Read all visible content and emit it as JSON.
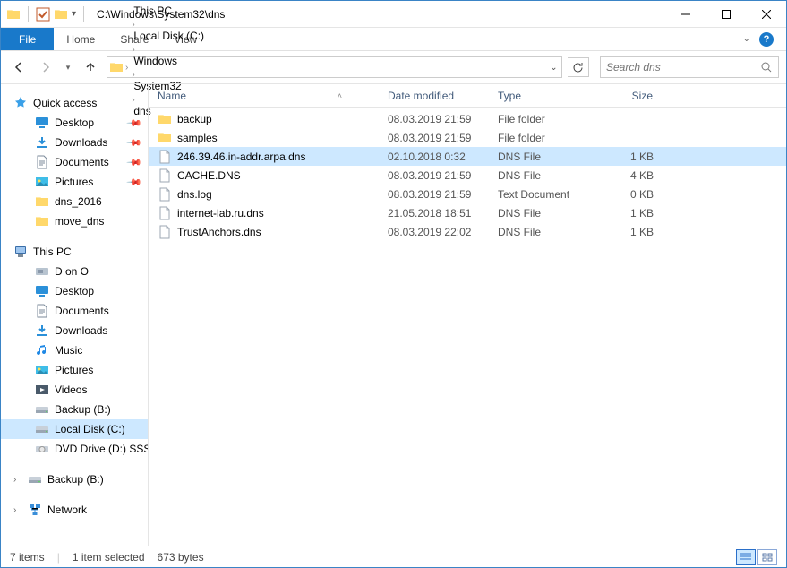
{
  "title": "C:\\Windows\\System32\\dns",
  "ribbon": {
    "file": "File",
    "home": "Home",
    "share": "Share",
    "view": "View"
  },
  "breadcrumbs": [
    "This PC",
    "Local Disk (C:)",
    "Windows",
    "System32",
    "dns"
  ],
  "search_placeholder": "Search dns",
  "sidebar": {
    "quick_access": "Quick access",
    "qa": [
      {
        "label": "Desktop",
        "pinned": true,
        "icon": "desktop"
      },
      {
        "label": "Downloads",
        "pinned": true,
        "icon": "downloads"
      },
      {
        "label": "Documents",
        "pinned": true,
        "icon": "documents"
      },
      {
        "label": "Pictures",
        "pinned": true,
        "icon": "pictures"
      },
      {
        "label": "dns_2016",
        "pinned": false,
        "icon": "folder"
      },
      {
        "label": "move_dns",
        "pinned": false,
        "icon": "folder"
      }
    ],
    "this_pc": "This PC",
    "pc": [
      {
        "label": "D on O",
        "icon": "drive"
      },
      {
        "label": "Desktop",
        "icon": "desktop"
      },
      {
        "label": "Documents",
        "icon": "documents"
      },
      {
        "label": "Downloads",
        "icon": "downloads"
      },
      {
        "label": "Music",
        "icon": "music"
      },
      {
        "label": "Pictures",
        "icon": "pictures"
      },
      {
        "label": "Videos",
        "icon": "videos"
      },
      {
        "label": "Backup (B:)",
        "icon": "disk"
      },
      {
        "label": "Local Disk (C:)",
        "icon": "disk",
        "selected": true
      },
      {
        "label": "DVD Drive (D:) SSS_X",
        "icon": "dvd"
      }
    ],
    "backup": "Backup (B:)",
    "network": "Network"
  },
  "columns": {
    "name": "Name",
    "date": "Date modified",
    "type": "Type",
    "size": "Size"
  },
  "files": [
    {
      "name": "backup",
      "date": "08.03.2019 21:59",
      "type": "File folder",
      "size": "",
      "icon": "folder"
    },
    {
      "name": "samples",
      "date": "08.03.2019 21:59",
      "type": "File folder",
      "size": "",
      "icon": "folder"
    },
    {
      "name": "246.39.46.in-addr.arpa.dns",
      "date": "02.10.2018 0:32",
      "type": "DNS File",
      "size": "1 KB",
      "icon": "file",
      "selected": true
    },
    {
      "name": "CACHE.DNS",
      "date": "08.03.2019 21:59",
      "type": "DNS File",
      "size": "4 KB",
      "icon": "file"
    },
    {
      "name": "dns.log",
      "date": "08.03.2019 21:59",
      "type": "Text Document",
      "size": "0 KB",
      "icon": "file"
    },
    {
      "name": "internet-lab.ru.dns",
      "date": "21.05.2018 18:51",
      "type": "DNS File",
      "size": "1 KB",
      "icon": "file"
    },
    {
      "name": "TrustAnchors.dns",
      "date": "08.03.2019 22:02",
      "type": "DNS File",
      "size": "1 KB",
      "icon": "file"
    }
  ],
  "status": {
    "items": "7 items",
    "selected": "1 item selected",
    "size": "673 bytes"
  },
  "icons": {
    "folder": "<svg viewBox='0 0 16 16'><path fill='#ffd86b' d='M1 3h5l1 1h8v9H1z'/><path fill='#ffe9a8' d='M1 3h5l1 1H1z'/></svg>",
    "file": "<svg viewBox='0 0 16 16'><path fill='#fff' stroke='#9da7b3' d='M3 1h7l3 3v11H3z'/><path fill='none' stroke='#9da7b3' d='M10 1v3h3'/></svg>",
    "desktop": "<svg viewBox='0 0 16 16'><rect x='1' y='2' width='14' height='9' fill='#2b90d9' rx='1'/><rect x='5' y='12' width='6' height='2' fill='#2b90d9'/></svg>",
    "downloads": "<svg viewBox='0 0 16 16'><path fill='#2b90d9' d='M8 2v7M5 6l3 3 3-3' stroke='#2b90d9' stroke-width='2' fill='none'/><rect x='2' y='12' width='12' height='2' fill='#2b90d9'/></svg>",
    "documents": "<svg viewBox='0 0 16 16'><path fill='#fff' stroke='#7b8a9a' d='M3 1h7l3 3v11H3z'/><path stroke='#7b8a9a' d='M5 7h6M5 9h6M5 11h4'/></svg>",
    "pictures": "<svg viewBox='0 0 16 16'><rect x='1' y='3' width='14' height='10' fill='#3fbde8'/><circle cx='5' cy='7' r='1.5' fill='#ffe24d'/><path fill='#2a8eb5' d='M1 13l5-5 4 3 2-2 3 4z'/></svg>",
    "music": "<svg viewBox='0 0 16 16'><path fill='#1e88e5' d='M6 3v8a2 2 0 11-1-1.7V5l7-1v6a2 2 0 11-1-1.7V2z'/></svg>",
    "videos": "<svg viewBox='0 0 16 16'><rect x='1' y='3' width='14' height='10' fill='#4a5a6a'/><path fill='#fff' d='M6 6l5 2-5 2z'/></svg>",
    "disk": "<svg viewBox='0 0 16 16'><rect x='1' y='5' width='14' height='7' fill='#c8d0d9' rx='1'/><rect x='1' y='9' width='14' height='3' fill='#9aa6b3'/><circle cx='13' cy='10.5' r='0.8' fill='#4fe04f'/></svg>",
    "drive": "<svg viewBox='0 0 16 16'><rect x='1' y='4' width='14' height='8' fill='#b8c4d0' rx='1'/><rect x='3' y='6' width='6' height='4' fill='#8a99ab'/></svg>",
    "dvd": "<svg viewBox='0 0 16 16'><rect x='1' y='5' width='14' height='7' fill='#c8d0d9' rx='1'/><circle cx='8' cy='8.5' r='3' fill='#e8e8e8' stroke='#999'/></svg>",
    "star": "<svg viewBox='0 0 16 16'><path fill='#3aa0e8' d='M8 1l2 4 4 .6-3 3 .7 4L8 10.8 4.3 12.6 5 8.6 2 5.6 6 5z'/></svg>",
    "pc": "<svg viewBox='0 0 16 16'><rect x='2' y='2' width='12' height='8' fill='#3a6ea8' rx='1'/><rect x='3' y='3' width='10' height='6' fill='#9fc6ef'/><rect x='5' y='11' width='6' height='3' fill='#7a8a9a'/></svg>",
    "network": "<svg viewBox='0 0 16 16'><rect x='2' y='2' width='5' height='4' fill='#3a8ed8'/><rect x='9' y='2' width='5' height='4' fill='#3a8ed8'/><rect x='5.5' y='10' width='5' height='4' fill='#3a8ed8'/><path stroke='#3a8ed8' d='M4.5 6v2h7V6M8 8v2'/></svg>",
    "check": "<svg viewBox='0 0 16 16'><rect x='1' y='1' width='14' height='14' fill='none' stroke='#c25a2a'/><path d='M4 8l3 3 5-6' stroke='#c25a2a' fill='none' stroke-width='2'/></svg>"
  }
}
